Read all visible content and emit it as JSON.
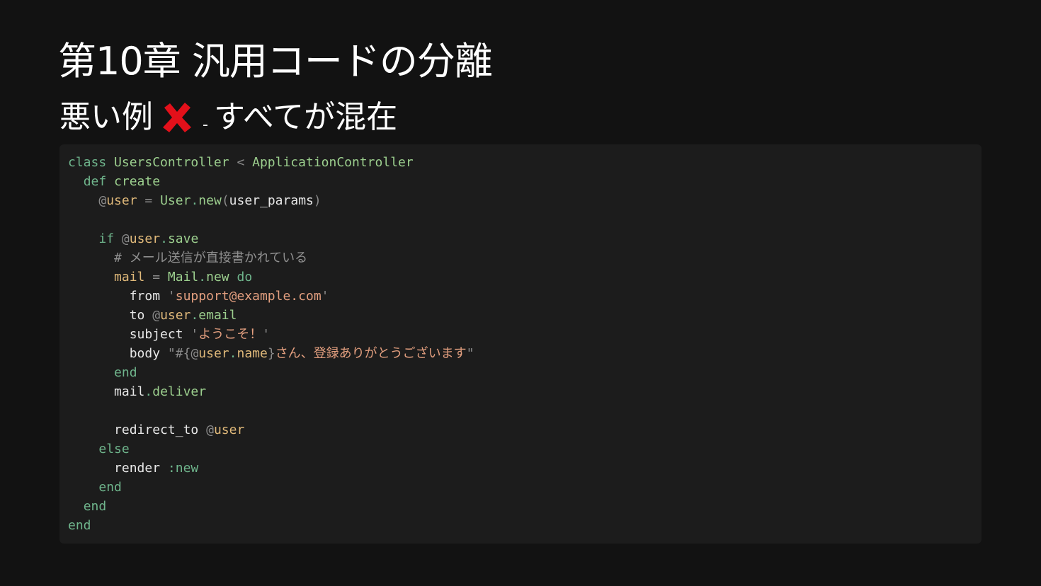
{
  "title": "第10章 汎用コードの分離",
  "subtitle": {
    "prefix": "悪い例",
    "icon": "red-cross-mark-icon",
    "icon_color": "#e3101a",
    "dash": "-",
    "text": "すべてが混在"
  },
  "code": {
    "language": "ruby",
    "lines": [
      "class UsersController < ApplicationController",
      "  def create",
      "    @user = User.new(user_params)",
      "",
      "    if @user.save",
      "      # メール送信が直接書かれている",
      "      mail = Mail.new do",
      "        from 'support@example.com'",
      "        to @user.email",
      "        subject 'ようこそ！'",
      "        body \"#{@user.name}さん、登録ありがとうございます\"",
      "      end",
      "      mail.deliver",
      "",
      "      redirect_to @user",
      "    else",
      "      render :new",
      "    end",
      "  end",
      "end"
    ]
  },
  "colors": {
    "background": "#121212",
    "code_background": "#1c1c1c",
    "keyword": "#6fb58c",
    "class_name": "#9ccf8e",
    "instance_variable": "#e0b97a",
    "string": "#e39f7f",
    "comment": "#8f8f8f"
  }
}
